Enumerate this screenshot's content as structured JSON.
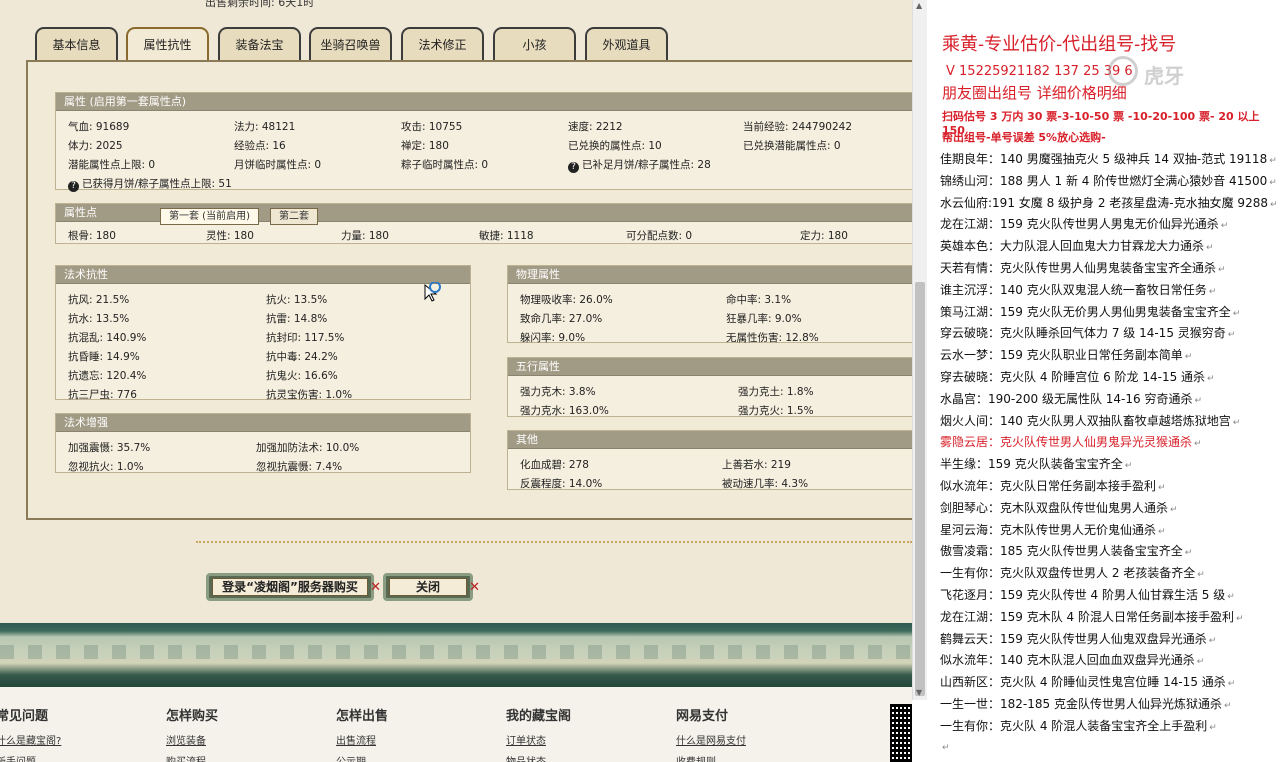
{
  "top_cut_text": "出售剩余时间: 6天1时",
  "tabs": [
    {
      "label": "基本信息"
    },
    {
      "label": "属性抗性"
    },
    {
      "label": "装备法宝"
    },
    {
      "label": "坐骑召唤兽"
    },
    {
      "label": "法术修正"
    },
    {
      "label": "小孩"
    },
    {
      "label": "外观道具"
    }
  ],
  "attributes": {
    "title": "属性 (启用第一套属性点)",
    "cells": [
      "气血: 91689",
      "法力: 48121",
      "攻击: 10755",
      "速度: 2212",
      "当前经验: 244790242",
      "体力: 2025",
      "经验点: 16",
      "禅定: 180",
      "已兑换的属性点: 10",
      "已兑换潜能属性点: 0",
      "潜能属性点上限: 0",
      "月饼临时属性点: 0",
      "粽子临时属性点: 0",
      "已补足月饼/粽子属性点: 28",
      "已获得月饼/粽子属性点上限: 51"
    ]
  },
  "attr_points": {
    "title": "属性点",
    "subtab1": "第一套 (当前启用)",
    "subtab2": "第二套",
    "cells": [
      "根骨: 180",
      "灵性: 180",
      "力量: 180",
      "敏捷: 1118",
      "可分配点数: 0",
      "定力: 180"
    ]
  },
  "magic_resist": {
    "title": "法术抗性",
    "cells": [
      "抗风: 21.5%",
      "抗火: 13.5%",
      "抗水: 13.5%",
      "抗雷: 14.8%",
      "抗混乱: 140.9%",
      "抗封印: 117.5%",
      "抗昏睡: 14.9%",
      "抗中毒: 24.2%",
      "抗遗忘: 120.4%",
      "抗鬼火: 16.6%",
      "抗三尸虫: 776",
      "抗灵宝伤害: 1.0%"
    ]
  },
  "magic_boost": {
    "title": "法术增强",
    "cells": [
      "加强震慑: 35.7%",
      "加强加防法术: 10.0%",
      "忽视抗火: 1.0%",
      "忽视抗震慑: 7.4%"
    ]
  },
  "physical": {
    "title": "物理属性",
    "cells": [
      "物理吸收率: 26.0%",
      "命中率: 3.1%",
      "致命几率: 27.0%",
      "狂暴几率: 9.0%",
      "躲闪率: 9.0%",
      "无属性伤害: 12.8%"
    ]
  },
  "five_elements": {
    "title": "五行属性",
    "cells": [
      "强力克木: 3.8%",
      "强力克土: 1.8%",
      "强力克水: 163.0%",
      "强力克火: 1.5%"
    ]
  },
  "other": {
    "title": "其他",
    "cells": [
      "化血成碧: 278",
      "上善若水: 219",
      "反震程度: 14.0%",
      "被动速几率: 4.3%"
    ]
  },
  "buttons": {
    "buy": "登录“凌烟阁”服务器购买",
    "close": "关闭"
  },
  "footer": [
    {
      "head": "常见问题",
      "link1": "什么是藏宝阁?",
      "link2": "新手问题"
    },
    {
      "head": "怎样购买",
      "link1": "浏览装备",
      "link2": "购买流程"
    },
    {
      "head": "怎样出售",
      "link1": "出售流程",
      "link2": "公示期"
    },
    {
      "head": "我的藏宝阁",
      "link1": "订单状态",
      "link2": "物品状态"
    },
    {
      "head": "网易支付",
      "link1": "什么是网易支付",
      "link2": "收费规则"
    }
  ],
  "right_panel": {
    "title": "乘黄-专业估价-代出组号-找号",
    "phone": "V 15225921182  137 25 39 6",
    "circle": "朋友圈出组号   详细价格明细",
    "price1": "扫码估号 3 万内 30 票-3-10-50 票 -10-20-100 票- 20 以上 150",
    "price2": "帮出组号-单号误差 5%放心选购-",
    "rows": [
      {
        "text": "佳期良年：140 男魔强抽克火 5 级神兵 14 双抽-范式 19118",
        "red": false
      },
      {
        "text": "锦绣山河：188 男人 1 新 4 阶传世燃灯全满心猿妙音 41500",
        "red": false
      },
      {
        "text": "水云仙府:191 女魔 8 级护身 2 老孩星盘涛-克水抽女魔 9288",
        "red": false
      },
      {
        "text": "龙在江湖：159 克火队传世男人男鬼无价仙异光通杀",
        "red": false
      },
      {
        "text": "英雄本色：大力队混人回血鬼大力甘霖龙大力通杀",
        "red": false
      },
      {
        "text": "天若有情：克火队传世男人仙男鬼装备宝宝齐全通杀",
        "red": false
      },
      {
        "text": "谁主沉浮：140 克火队双鬼混人统一畜牧日常任务",
        "red": false
      },
      {
        "text": "策马江湖：159 克火队无价男人男仙男鬼装备宝宝齐全",
        "red": false
      },
      {
        "text": "穿云破晓：克火队睡杀回气体力 7 级 14-15 灵猴穷奇",
        "red": false
      },
      {
        "text": "云水一梦：159 克火队职业日常任务副本简单",
        "red": false
      },
      {
        "text": "穿去破晓：克火队 4 阶睡宫位 6 阶龙 14-15 通杀",
        "red": false
      },
      {
        "text": "水晶宫：190-200 级无属性队 14-16 穷奇通杀",
        "red": false
      },
      {
        "text": "烟火人间：140 克火队男人双抽队畜牧卓越塔炼狱地宫",
        "red": false
      },
      {
        "text": "雾隐云居：克火队传世男人仙男鬼异光灵猴通杀",
        "red": true
      },
      {
        "text": "半生缘：159 克火队装备宝宝齐全",
        "red": false
      },
      {
        "text": "似水流年：克火队日常任务副本接手盈利",
        "red": false
      },
      {
        "text": "剑胆琴心：克木队双盘队传世仙鬼男人通杀",
        "red": false
      },
      {
        "text": "星河云海：克木队传世男人无价鬼仙通杀",
        "red": false
      },
      {
        "text": "傲雪凌霜：185 克火队传世男人装备宝宝齐全",
        "red": false
      },
      {
        "text": "一生有你：克火队双盘传世男人 2 老孩装备齐全",
        "red": false
      },
      {
        "text": "飞花逐月：159 克火队传世 4 阶男人仙甘霖生活 5 级",
        "red": false
      },
      {
        "text": "龙在江湖：159 克木队 4 阶混人日常任务副本接手盈利",
        "red": false
      },
      {
        "text": "鹤舞云天：159 克火队传世男人仙鬼双盘异光通杀",
        "red": false
      },
      {
        "text": "似水流年：140 克木队混人回血血双盘异光通杀",
        "red": false
      },
      {
        "text": "山西新区：克火队 4 阶睡仙灵性鬼宫位睡 14-15 通杀",
        "red": false
      },
      {
        "text": "一生一世：182-185 克金队传世男人仙异光炼狱通杀",
        "red": false
      },
      {
        "text": "一生有你：克火队 4 阶混人装备宝宝齐全上手盈利",
        "red": false
      }
    ]
  }
}
